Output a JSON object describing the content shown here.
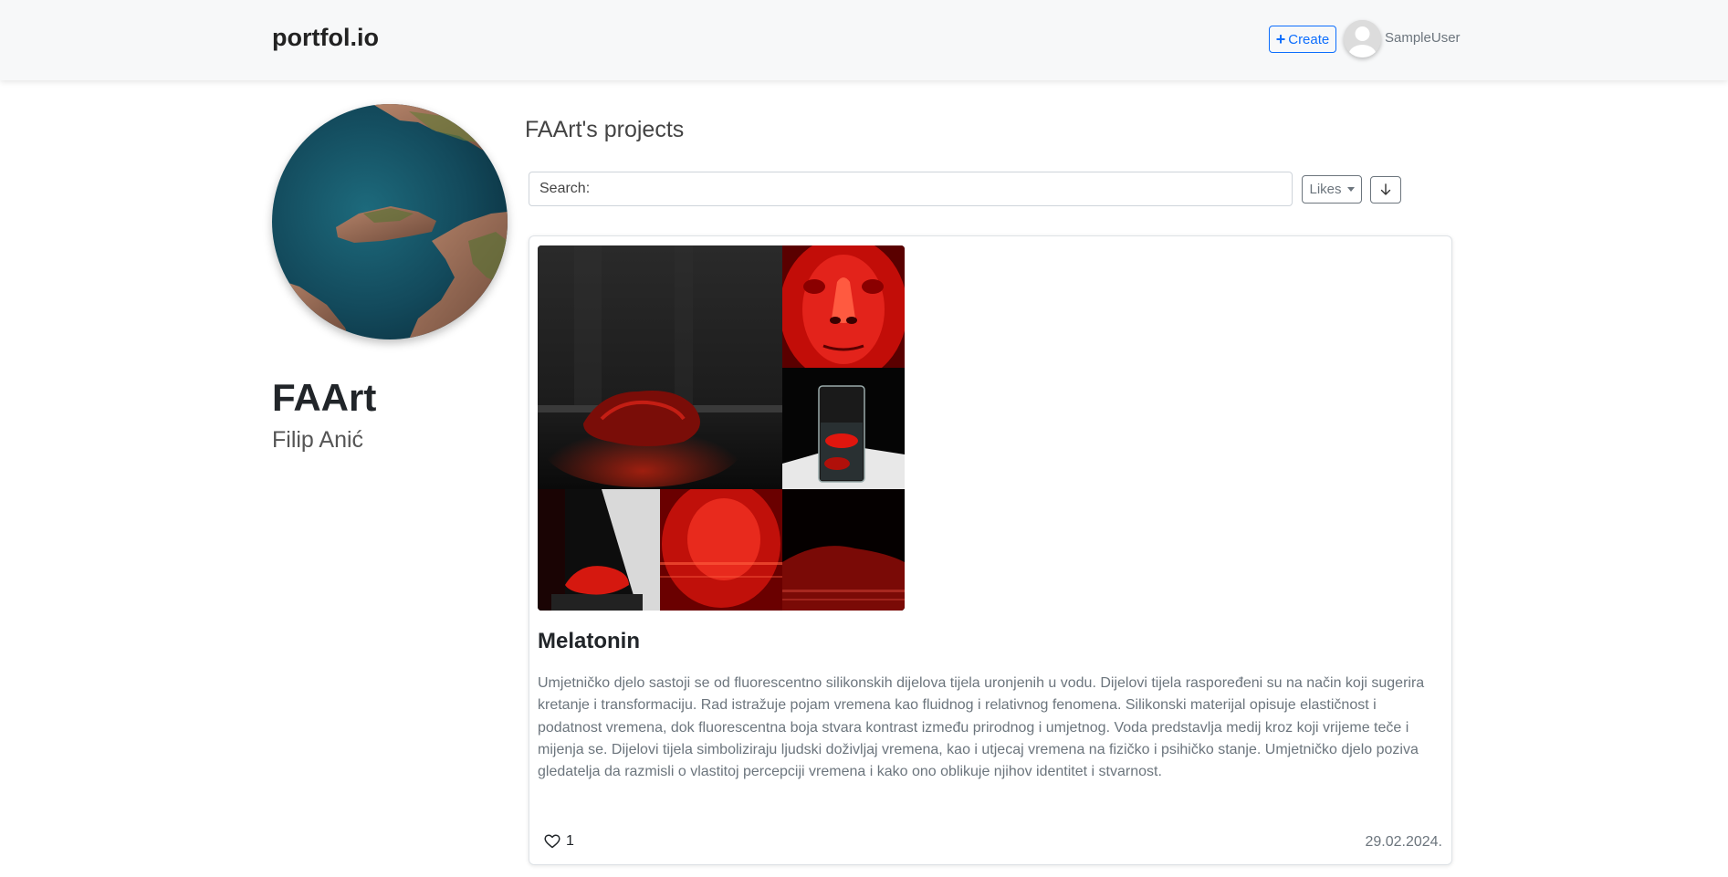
{
  "navbar": {
    "brand": "portfol.io",
    "create_label": "Create",
    "username": "SampleUser"
  },
  "profile": {
    "handle": "FAArt",
    "full_name": "Filip Anić"
  },
  "projects": {
    "title": "FAArt's projects",
    "search_label": "Search:",
    "search_value": "",
    "sort_selected": "Likes",
    "order_icon": "arrow-down-icon"
  },
  "project_card": {
    "title": "Melatonin",
    "description": "Umjetničko djelo sastoji se od fluorescentno silikonskih dijelova tijela uronjenih u vodu. Dijelovi tijela raspoređeni su na način koji sugerira kretanje i transformaciju. Rad istražuje pojam vremena kao fluidnog i relativnog fenomena. Silikonski materijal opisuje elastičnost i podatnost vremena, dok fluorescentna boja stvara kontrast između prirodnog i umjetnog. Voda predstavlja medij kroz koji vrijeme teče i mijenja se. Dijelovi tijela simboliziraju ljudski doživljaj vremena, kao i utjecaj vremena na fizičko i psihičko stanje. Umjetničko djelo poziva gledatelja da razmisli o vlastitoj percepciji vremena i kako ono oblikuje njihov identitet i stvarnost.",
    "likes": "1",
    "date": "29.02.2024."
  },
  "colors": {
    "accent": "#0d6efd",
    "muted": "#6c757d",
    "navbar_bg": "#f7f8f9"
  }
}
